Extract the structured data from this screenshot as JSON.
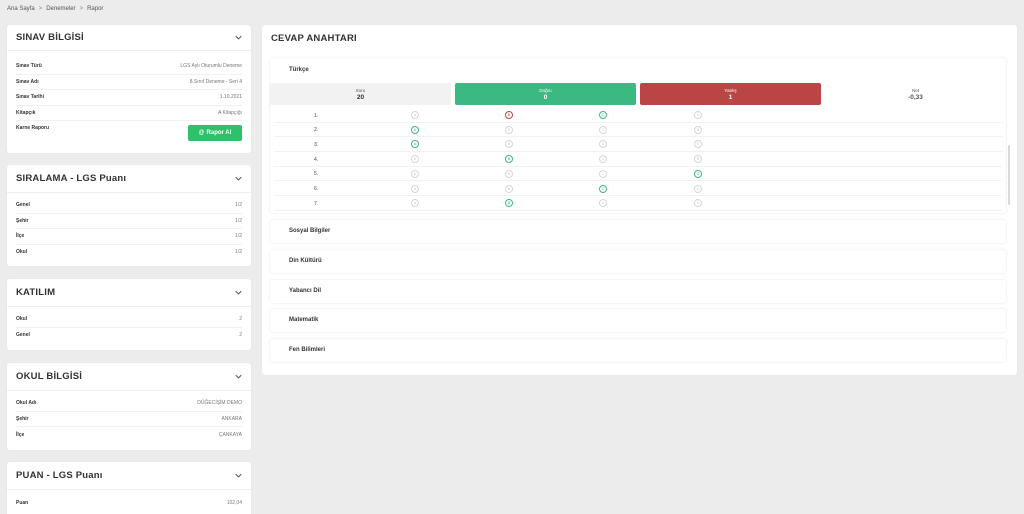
{
  "breadcrumb": {
    "home": "Ana Sayfa",
    "sep1": ">",
    "exams": "Denemeler",
    "sep2": ">",
    "current": "Rapor"
  },
  "sinav": {
    "title": "SINAV BİLGİSİ",
    "rows": [
      {
        "k": "Sınav Türü",
        "v": "LGS Aylı Oturumlu Deneme"
      },
      {
        "k": "Sınav Adı",
        "v": "8.Sınıf Deneme - Seri 4"
      },
      {
        "k": "Sınav Tarihi",
        "v": "1.10.2021"
      },
      {
        "k": "Kitapçık",
        "v": "A Kitapçığı"
      }
    ],
    "karne_label": "Karne Raporu",
    "rapor_button": "Rapor Al"
  },
  "siralama": {
    "title": "SIRALAMA - LGS Puanı",
    "rows": [
      {
        "k": "Genel",
        "v": "1/2"
      },
      {
        "k": "Şehir",
        "v": "1/2"
      },
      {
        "k": "İlçe",
        "v": "1/2"
      },
      {
        "k": "Okul",
        "v": "1/2"
      }
    ]
  },
  "katilim": {
    "title": "KATILIM",
    "rows": [
      {
        "k": "Okul",
        "v": "2"
      },
      {
        "k": "Genel",
        "v": "2"
      }
    ]
  },
  "okul": {
    "title": "OKUL BİLGİSİ",
    "rows": [
      {
        "k": "Okul Adı",
        "v": "DÜĞECİŞİM DEMO"
      },
      {
        "k": "Şehir",
        "v": "ANKARA"
      },
      {
        "k": "İlçe",
        "v": "ÇANKAYA"
      }
    ]
  },
  "puan": {
    "title": "PUAN - LGS Puanı",
    "rows": [
      {
        "k": "Puan",
        "v": "102,04"
      }
    ]
  },
  "cevap": {
    "title": "CEVAP ANAHTARI",
    "turkce_title": "Türkçe",
    "stats": {
      "soru_label": "Soru",
      "soru_val": "20",
      "dogru_label": "Doğru",
      "dogru_val": "0",
      "yanlis_label": "Yanlış",
      "yanlis_val": "1",
      "net_label": "Net",
      "net_val": "-0,33"
    },
    "questions": [
      {
        "n": "1.",
        "correct": "C",
        "wrong": "B"
      },
      {
        "n": "2.",
        "correct": "A",
        "wrong": ""
      },
      {
        "n": "3.",
        "correct": "A",
        "wrong": ""
      },
      {
        "n": "4.",
        "correct": "B",
        "wrong": ""
      },
      {
        "n": "5.",
        "correct": "D",
        "wrong": ""
      },
      {
        "n": "6.",
        "correct": "C",
        "wrong": ""
      },
      {
        "n": "7.",
        "correct": "B",
        "wrong": ""
      }
    ],
    "options": [
      "A",
      "B",
      "C",
      "D"
    ],
    "subjects": [
      "Sosyal Bilgiler",
      "Din Kültürü",
      "Yabancı Dil",
      "Matematik",
      "Fen Bilimleri"
    ]
  },
  "colors": {
    "green": "#3cb882",
    "red": "#b94545",
    "button_green": "#2ec06a"
  }
}
